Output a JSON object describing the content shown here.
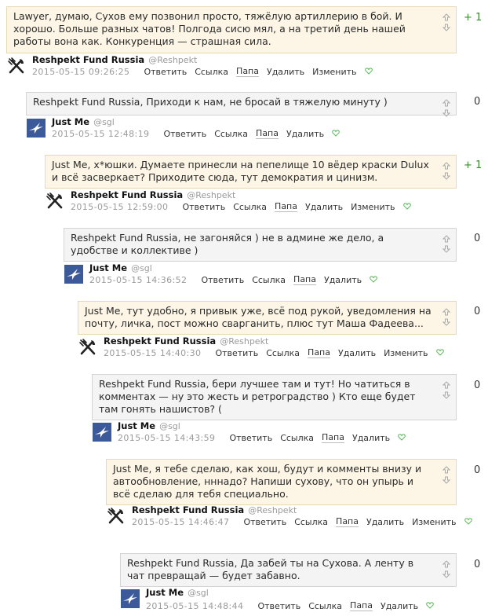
{
  "comments": [
    {
      "text": "Lawyer, думаю, Сухов ему позвонил просто, тяжёлую артиллерию в бой. И хорошо. Больше разных чатов! Полгода сисю мял, а на третий день нашей работы вона как. Конкуренция — страшная сила.",
      "score": "+ 1",
      "author": "Reshpekt Fund Russia",
      "handle": "@Reshpekt",
      "date": "2015-05-15 09:26:25",
      "avatar": "fork-knife-icon",
      "actions": [
        "Ответить",
        "Ссылка",
        "Папа",
        "Удалить",
        "Изменить"
      ]
    },
    {
      "text": "Reshpekt Fund Russia, Приходи к нам, не бросай в тяжелую минуту )",
      "score": "0",
      "author": "Just Me",
      "handle": "@sgl",
      "date": "2015-05-15 12:48:19",
      "avatar": "bird-icon",
      "actions": [
        "Ответить",
        "Ссылка",
        "Папа",
        "Удалить"
      ]
    },
    {
      "text": "Just Me, х*юшки. Думаете принесли на пепелище 10 вёдер краски Dulux и всё засверкает? Приходите сюда, тут демократия и цинизм.",
      "score": "+ 1",
      "author": "Reshpekt Fund Russia",
      "handle": "@Reshpekt",
      "date": "2015-05-15 12:59:00",
      "avatar": "fork-knife-icon",
      "actions": [
        "Ответить",
        "Ссылка",
        "Папа",
        "Удалить",
        "Изменить"
      ]
    },
    {
      "text": "Reshpekt Fund Russia, не загоняйся ) не в админе же дело, а удобстве и коллективе )",
      "score": "0",
      "author": "Just Me",
      "handle": "@sgl",
      "date": "2015-05-15 14:36:52",
      "avatar": "bird-icon",
      "actions": [
        "Ответить",
        "Ссылка",
        "Папа",
        "Удалить"
      ]
    },
    {
      "text": "Just Me, тут удобно, я привык уже, всё под рукой, уведомления на почту, личка, пост можно сварганить, плюс тут Маша Фадеева...",
      "score": "0",
      "author": "Reshpekt Fund Russia",
      "handle": "@Reshpekt",
      "date": "2015-05-15 14:40:30",
      "avatar": "fork-knife-icon",
      "actions": [
        "Ответить",
        "Ссылка",
        "Папа",
        "Удалить",
        "Изменить"
      ]
    },
    {
      "text": "Reshpekt Fund Russia, бери лучшее там и тут! Но чатиться в комментах — ну это жесть и ретроградство ) Кто еще будет там гонять нашистов? (",
      "score": "0",
      "author": "Just Me",
      "handle": "@sgl",
      "date": "2015-05-15 14:43:59",
      "avatar": "bird-icon",
      "actions": [
        "Ответить",
        "Ссылка",
        "Папа",
        "Удалить"
      ]
    },
    {
      "text": "Just Me, я тебе сделаю, как хош, будут и комменты внизу и автообновление, нннадо? Напиши сухову, что он упырь и всё сделаю для тебя специально.",
      "score": "0",
      "author": "Reshpekt Fund Russia",
      "handle": "@Reshpekt",
      "date": "2015-05-15 14:46:47",
      "avatar": "fork-knife-icon",
      "actions": [
        "Ответить",
        "Ссылка",
        "Папа",
        "Удалить",
        "Изменить"
      ]
    },
    {
      "text": "Reshpekt Fund Russia, Да забей ты на Сухова. А ленту в чат превращай — будет забавно.",
      "score": "0",
      "author": "Just Me",
      "handle": "@sgl",
      "date": "2015-05-15 14:48:44",
      "avatar": "bird-icon",
      "actions": [
        "Ответить",
        "Ссылка",
        "Папа",
        "Удалить"
      ]
    }
  ]
}
